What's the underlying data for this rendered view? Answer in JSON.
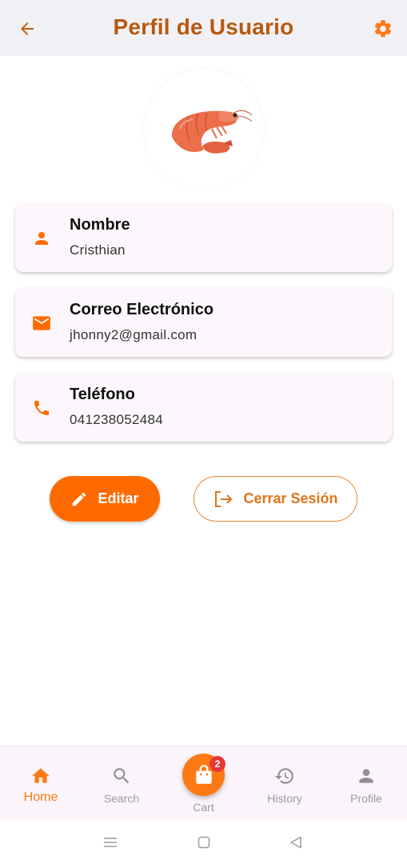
{
  "appbar": {
    "title": "Perfil de Usuario",
    "back_icon": "arrow-back-icon",
    "settings_icon": "gear-icon"
  },
  "profile": {
    "avatar_icon": "shrimp-image",
    "fields": [
      {
        "icon": "person-icon",
        "label": "Nombre",
        "value": "Cristhian"
      },
      {
        "icon": "email-icon",
        "label": "Correo Electrónico",
        "value": "jhonny2@gmail.com"
      },
      {
        "icon": "phone-icon",
        "label": "Teléfono",
        "value": "041238052484"
      }
    ]
  },
  "actions": {
    "edit_label": "Editar",
    "logout_label": "Cerrar Sesión"
  },
  "bottom_nav": {
    "items": [
      {
        "label": "Home",
        "icon": "home-icon",
        "active": true
      },
      {
        "label": "Search",
        "icon": "search-icon",
        "active": false
      },
      {
        "label": "Cart",
        "icon": "shopping-bag-icon",
        "badge": "2",
        "active": false
      },
      {
        "label": "History",
        "icon": "history-icon",
        "active": false
      },
      {
        "label": "Profile",
        "icon": "person-icon",
        "active": false
      }
    ]
  },
  "colors": {
    "accent": "#ff6a00",
    "title": "#b8590e",
    "card_bg": "#fdf7fd",
    "nav_bg": "#fcf4fb",
    "badge": "#e53935"
  }
}
